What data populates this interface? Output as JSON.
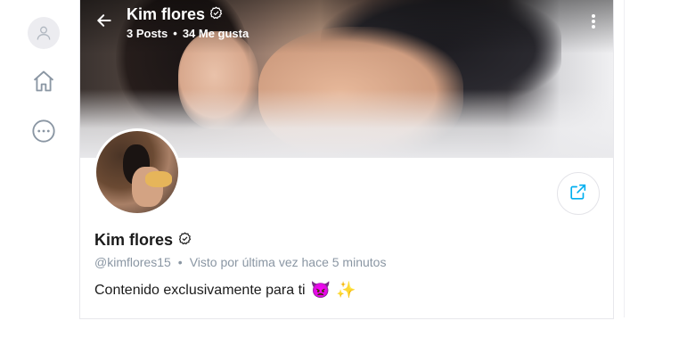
{
  "nav": {
    "avatar_icon": "user-icon",
    "home_icon": "home-icon",
    "more_icon": "more-circle-icon"
  },
  "header": {
    "name": "Kim flores",
    "posts": "3 Posts",
    "separator": "•",
    "likes": "34 Me gusta",
    "back_icon": "arrow-left-icon",
    "menu_icon": "vertical-dots-icon"
  },
  "profile": {
    "name": "Kim flores",
    "handle": "@kimflores15",
    "separator": "•",
    "last_seen": "Visto por última vez hace 5 minutos",
    "bio": "Contenido exclusivamente para ti",
    "bio_emoji_1": "👿",
    "bio_emoji_2": "✨",
    "share_icon": "share-icon",
    "verified_icon": "verified-icon"
  },
  "colors": {
    "accent": "#00aff0",
    "muted_text": "#8a96a3",
    "nav_icon": "#8a96a3"
  }
}
